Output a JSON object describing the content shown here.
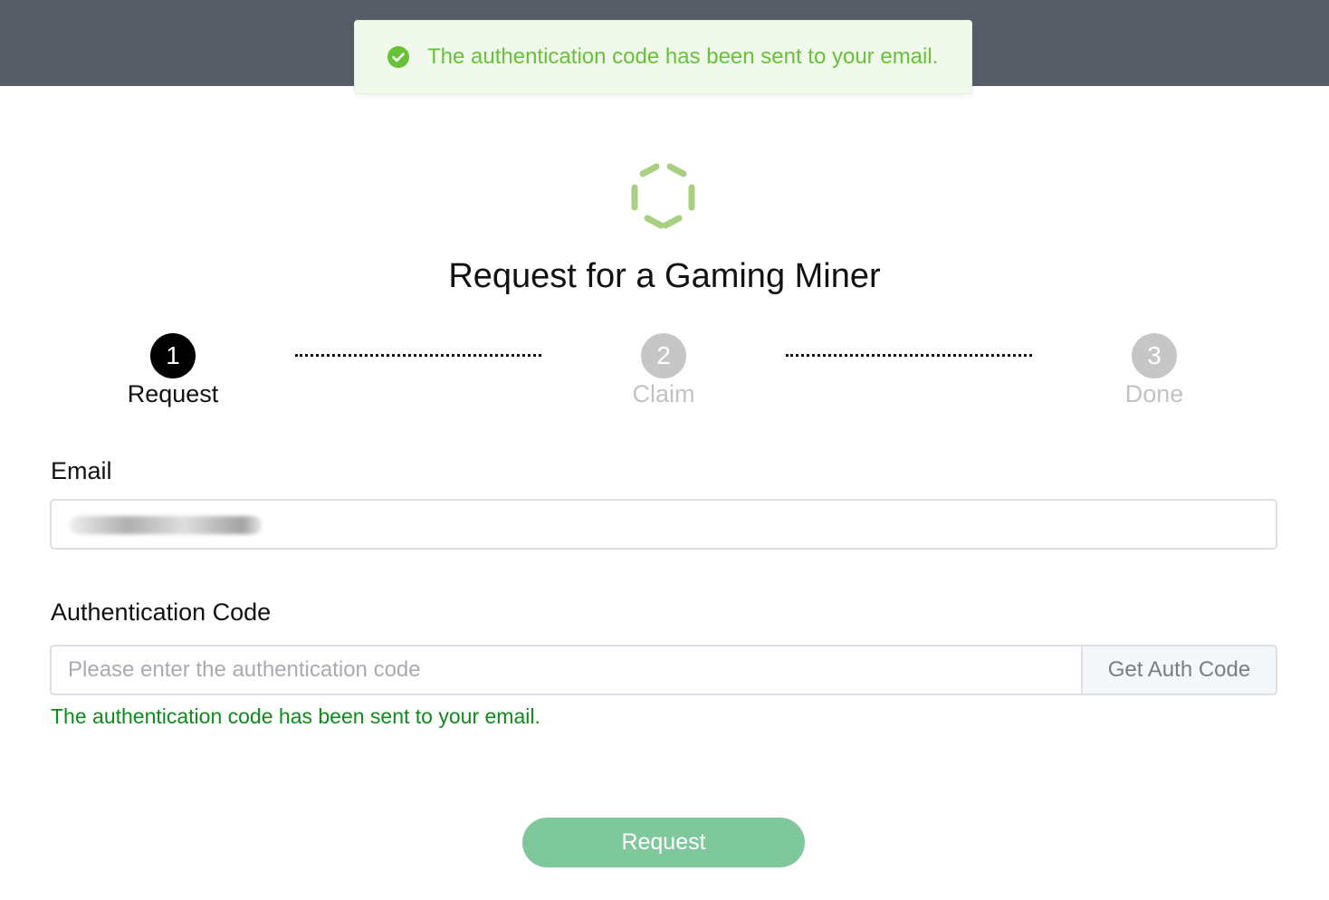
{
  "toast": {
    "message": "The authentication code has been sent to your email.",
    "icon": "check-circle-icon",
    "color": "#67c23a"
  },
  "logo": {
    "icon": "hexagon-logo-icon",
    "color": "#a9cf82"
  },
  "page": {
    "title": "Request for a Gaming Miner"
  },
  "steps": [
    {
      "number": "1",
      "label": "Request",
      "state": "active"
    },
    {
      "number": "2",
      "label": "Claim",
      "state": "inactive"
    },
    {
      "number": "3",
      "label": "Done",
      "state": "inactive"
    }
  ],
  "form": {
    "email_label": "Email",
    "auth_label": "Authentication Code",
    "auth_placeholder": "Please enter the authentication code",
    "get_code_label": "Get Auth Code",
    "hint": "The authentication code has been sent to your email.",
    "submit_label": "Request"
  },
  "colors": {
    "topbar": "#565d66",
    "submit": "#7fc89b",
    "hint": "#0f8a1e"
  }
}
